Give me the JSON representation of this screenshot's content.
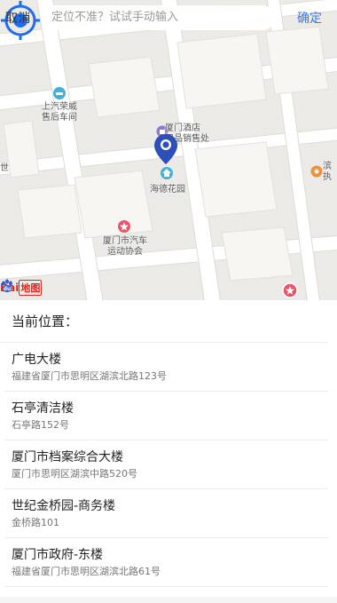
{
  "topbar": {
    "cancel_label": "取消",
    "search_placeholder": "定位不准？试试手动输入",
    "confirm_label": "确定"
  },
  "map": {
    "pois": [
      {
        "label": "上汽荣威\n售后车间",
        "icon": "car-service-icon"
      },
      {
        "label": "厦门酒店\n用品销售处",
        "icon": "shop-icon"
      },
      {
        "label": "海德花园",
        "icon": "residence-icon"
      },
      {
        "label": "厦门市汽车\n运动协会",
        "icon": "star-poi-icon"
      },
      {
        "label": "滨\n执",
        "icon": "poi-icon"
      },
      {
        "label": "世",
        "icon": "none"
      }
    ],
    "logo_text_bai": "Bai",
    "logo_text_du": "du",
    "logo_text_map": "地图"
  },
  "list": {
    "header": "当前位置：",
    "items": [
      {
        "name": "广电大楼",
        "address": "福建省厦门市思明区湖滨北路123号"
      },
      {
        "name": "石亭清洁楼",
        "address": "石亭路152号"
      },
      {
        "name": "厦门市档案综合大楼",
        "address": "厦门市思明区湖滨中路520号"
      },
      {
        "name": "世纪金桥园-商务楼",
        "address": "金桥路101"
      },
      {
        "name": "厦门市政府-东楼",
        "address": "福建省厦门市思明区湖滨北路61号"
      }
    ]
  },
  "colors": {
    "accent": "#3b78e7",
    "pin": "#2c4fb8",
    "locate": "#1e6cf0"
  }
}
